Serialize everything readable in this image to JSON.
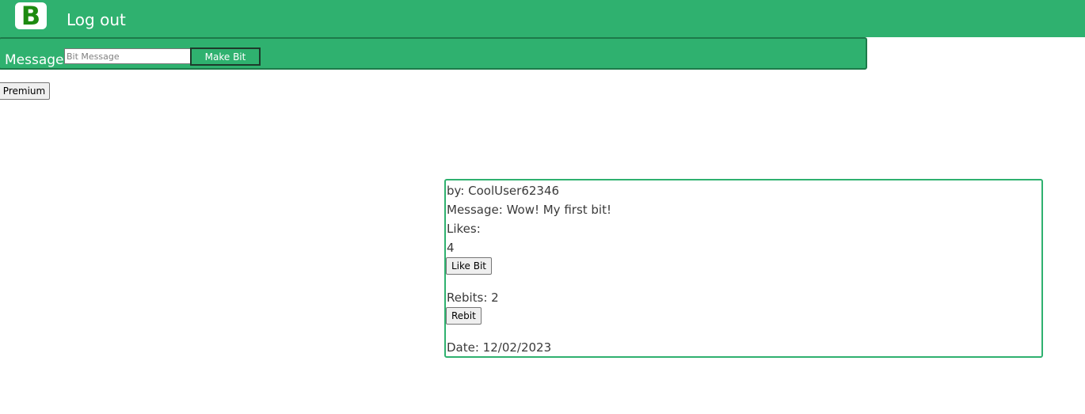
{
  "header": {
    "logo_letter": "B",
    "logout_label": "Log out",
    "brand_color": "#2fb16f"
  },
  "composer": {
    "label": "Message:",
    "input_placeholder": "Bit Message",
    "input_value": "",
    "submit_label": "Make Bit"
  },
  "premium_label": "Premium",
  "bit": {
    "author_text": "by: CoolUser62346",
    "message_text": "Message: Wow! My first bit!",
    "likes_label": "Likes:",
    "likes_count": "4",
    "like_button_label": "Like Bit",
    "rebits_text": "Rebits: 2",
    "rebit_button_label": "Rebit",
    "date_text": "Date: 12/02/2023"
  }
}
